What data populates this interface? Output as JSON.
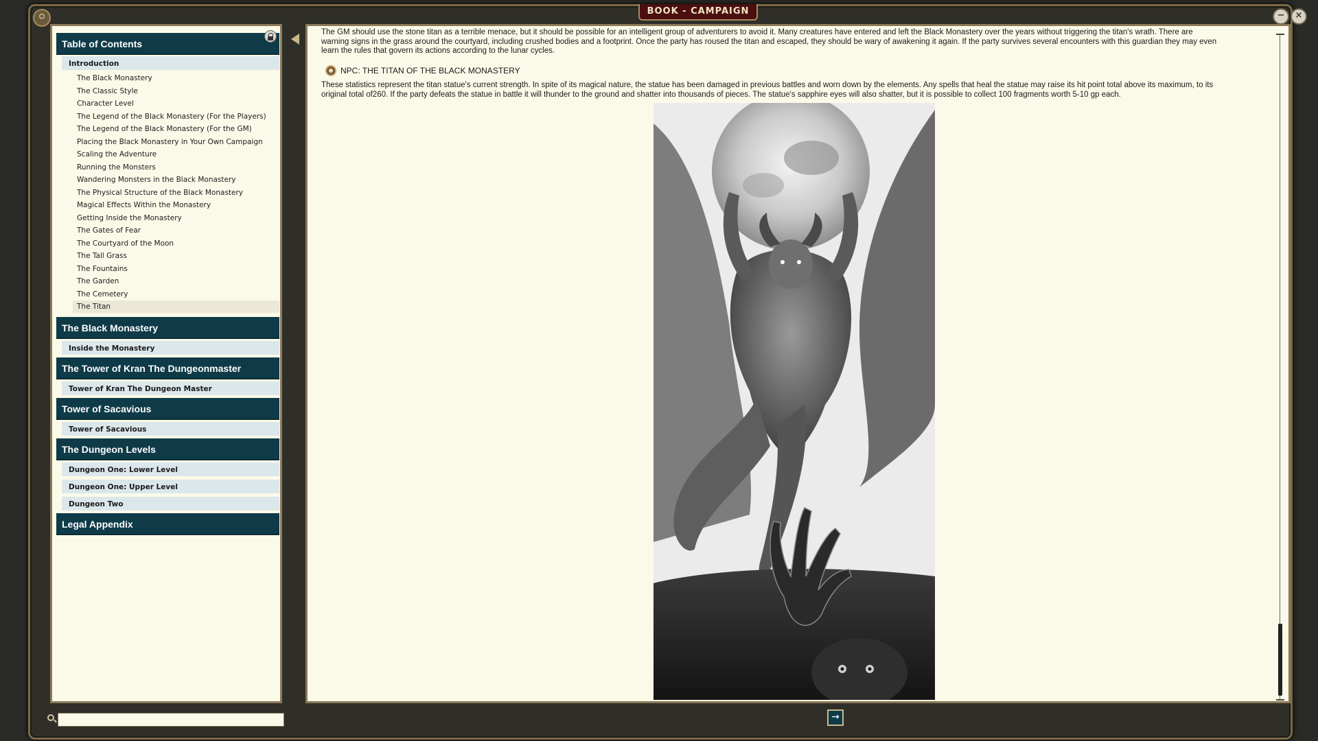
{
  "window": {
    "title": "BOOK - CAMPAIGN"
  },
  "toc": {
    "sections": [
      {
        "title": "Table of Contents",
        "items": [
          {
            "label": "Introduction",
            "subitems": [
              "The Black Monastery",
              "The Classic Style",
              "Character Level",
              "The Legend of the Black Monastery (For the Players)",
              "The Legend of the Black Monastery (For the GM)",
              "Placing the Black Monastery in Your Own Campaign",
              "Scaling the Adventure",
              "Running the Monsters",
              "Wandering Monsters in the  Black Monastery",
              "The Physical Structure of the Black Monastery",
              "Magical Effects Within the Monastery",
              "Getting Inside the Monastery",
              "The Gates of Fear",
              "The Courtyard of the Moon",
              "The Tall Grass",
              "The Fountains",
              "The Garden",
              "The Cemetery",
              "The Titan"
            ]
          }
        ]
      },
      {
        "title": "The Black Monastery",
        "items": [
          {
            "label": "Inside the Monastery"
          }
        ]
      },
      {
        "title": "The Tower of Kran The Dungeonmaster",
        "items": [
          {
            "label": "Tower of Kran The Dungeon Master"
          }
        ]
      },
      {
        "title": "Tower of Sacavious",
        "items": [
          {
            "label": "Tower of Sacavious"
          }
        ]
      },
      {
        "title": "The Dungeon Levels",
        "items": [
          {
            "label": "Dungeon One: Lower Level"
          },
          {
            "label": "Dungeon One: Upper Level"
          },
          {
            "label": "Dungeon Two"
          }
        ]
      },
      {
        "title": "Legal Appendix",
        "items": []
      }
    ],
    "selected_subitem": "The Titan"
  },
  "content": {
    "para1_line1": "The GM should use the stone titan as a terrible menace, but it should be possible for an intelligent group of adventurers to avoid it. Many creatures have entered and left the Black Monastery over the years without triggering the titan's wrath. There are",
    "para1_line2": "warning signs in the grass around the courtyard, including crushed bodies and a footprint. Once the party has roused the titan and escaped, they should be wary of awakening it again. If the party survives several encounters with this guardian they may even",
    "para1_line3": "learn the rules that govern its actions according to the lunar cycles.",
    "npc_link": "NPC: THE TITAN OF THE BLACK MONASTERY",
    "para2_line1": "These statistics represent the titan statue's current strength. In spite of its magical nature, the statue has been damaged in previous battles and worn down by the elements. Any spells that heal the statue may raise its hit point total above its maximum, to its",
    "para2_line2": "original total of260. If the party defeats the statue in battle it will thunder to the ground and shatter into thousands of pieces. The statue's sapphire eyes will also shatter, but it is possible to collect 100 fragments worth 5-10 gp each."
  },
  "search": {
    "value": ""
  },
  "icons": {
    "next": "arrow-right-icon",
    "search": "magnifier-icon",
    "lock": "lock-icon"
  },
  "colors": {
    "section_header": "#0f3b48",
    "panel_bg": "#fbfae9",
    "title_tab": "#4b0f0f"
  }
}
